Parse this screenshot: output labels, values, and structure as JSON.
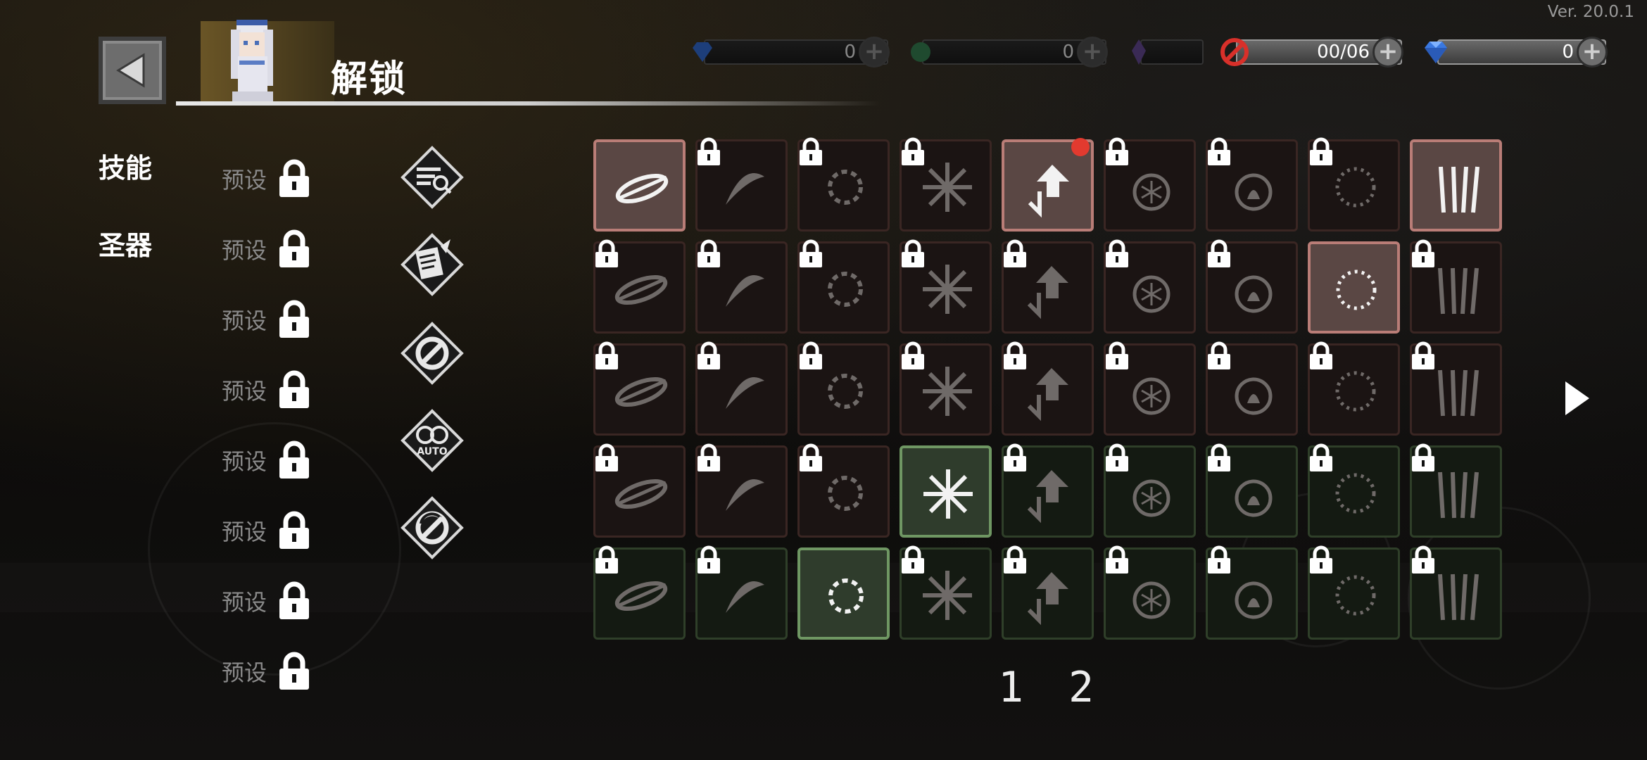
{
  "version": "Ver. 20.0.1",
  "header": {
    "title": "解锁"
  },
  "currencies": [
    {
      "icon": "diamond-icon",
      "value": "0",
      "active": false
    },
    {
      "icon": "green-orb-icon",
      "value": "0",
      "active": false
    },
    {
      "icon": "purple-crystal-icon",
      "value": "",
      "active": false
    },
    {
      "icon": "no-entry-icon",
      "value": "00/06",
      "active": true
    },
    {
      "icon": "diamond-icon",
      "value": "0",
      "active": true
    }
  ],
  "nav": {
    "skills_label": "技能",
    "relics_label": "圣器"
  },
  "presets": [
    {
      "label": "预设",
      "locked": true
    },
    {
      "label": "预设",
      "locked": true
    },
    {
      "label": "预设",
      "locked": true
    },
    {
      "label": "预设",
      "locked": true
    },
    {
      "label": "预设",
      "locked": true
    },
    {
      "label": "预设",
      "locked": true
    },
    {
      "label": "预设",
      "locked": true
    },
    {
      "label": "预设",
      "locked": true
    }
  ],
  "utility_icons": [
    "filter-search-icon",
    "scroll-quill-icon",
    "no-entry-diamond-icon",
    "auto-icon",
    "no-cycle-icon"
  ],
  "utility_auto_text": "AUTO",
  "skills": [
    {
      "icon": "slash-orbit-icon",
      "locked": false,
      "active": true,
      "tier": "red"
    },
    {
      "icon": "sword-spin-icon",
      "locked": true,
      "active": false,
      "tier": "red"
    },
    {
      "icon": "explosion-icon",
      "locked": true,
      "active": false,
      "tier": "red"
    },
    {
      "icon": "burst-icon",
      "locked": true,
      "active": false,
      "tier": "red"
    },
    {
      "icon": "arrows-up-down-icon",
      "locked": false,
      "active": true,
      "tier": "red",
      "notification": true
    },
    {
      "icon": "frost-bomb-icon",
      "locked": true,
      "active": false,
      "tier": "red"
    },
    {
      "icon": "fire-bomb-icon",
      "locked": true,
      "active": false,
      "tier": "red"
    },
    {
      "icon": "vortex-ring-icon",
      "locked": true,
      "active": false,
      "tier": "red"
    },
    {
      "icon": "spikes-icon",
      "locked": false,
      "active": true,
      "tier": "red"
    },
    {
      "icon": "biohazard-icon",
      "locked": true,
      "active": false,
      "tier": "red"
    },
    {
      "icon": "crescent-blade-icon",
      "locked": true,
      "active": false,
      "tier": "red"
    },
    {
      "icon": "wind-slash-icon",
      "locked": true,
      "active": false,
      "tier": "red"
    },
    {
      "icon": "comet-icon",
      "locked": true,
      "active": false,
      "tier": "red"
    },
    {
      "icon": "crosshair-icon",
      "locked": true,
      "active": false,
      "tier": "red"
    },
    {
      "icon": "ice-sword-icon",
      "locked": true,
      "active": false,
      "tier": "red"
    },
    {
      "icon": "spiral-icon",
      "locked": true,
      "active": false,
      "tier": "red"
    },
    {
      "icon": "target-orb-icon",
      "locked": false,
      "active": true,
      "tier": "red"
    },
    {
      "icon": "thorn-vine-icon",
      "locked": true,
      "active": false,
      "tier": "red"
    },
    {
      "icon": "poison-cloud-icon",
      "locked": true,
      "active": false,
      "tier": "red"
    },
    {
      "icon": "fist-icon",
      "locked": true,
      "active": false,
      "tier": "red"
    },
    {
      "icon": "eye-ring-icon",
      "locked": true,
      "active": false,
      "tier": "red"
    },
    {
      "icon": "claw-slash-icon",
      "locked": true,
      "active": false,
      "tier": "red"
    },
    {
      "icon": "lightning-bomb-icon",
      "locked": true,
      "active": false,
      "tier": "red"
    },
    {
      "icon": "feather-slash-icon",
      "locked": true,
      "active": false,
      "tier": "red"
    },
    {
      "icon": "spear-icon",
      "locked": true,
      "active": false,
      "tier": "red"
    },
    {
      "icon": "cross-slash-icon",
      "locked": true,
      "active": false,
      "tier": "red"
    },
    {
      "icon": "pulse-wave-icon",
      "locked": true,
      "active": false,
      "tier": "red"
    },
    {
      "icon": "fireball-icon",
      "locked": true,
      "active": false,
      "tier": "red"
    },
    {
      "icon": "grass-burst-icon",
      "locked": true,
      "active": false,
      "tier": "red"
    },
    {
      "icon": "splash-icon",
      "locked": true,
      "active": false,
      "tier": "red"
    },
    {
      "icon": "shark-fin-icon",
      "locked": false,
      "active": true,
      "tier": "green"
    },
    {
      "icon": "chain-icon",
      "locked": true,
      "active": false,
      "tier": "green"
    },
    {
      "icon": "lightning-icon",
      "locked": true,
      "active": false,
      "tier": "green"
    },
    {
      "icon": "anvil-icon",
      "locked": true,
      "active": false,
      "tier": "green"
    },
    {
      "icon": "flame-ring-icon",
      "locked": true,
      "active": false,
      "tier": "green"
    },
    {
      "icon": "skull-burst-icon",
      "locked": true,
      "active": false,
      "tier": "green"
    },
    {
      "icon": "biohazard-icon",
      "locked": true,
      "active": false,
      "tier": "green"
    },
    {
      "icon": "lance-icon",
      "locked": true,
      "active": false,
      "tier": "green"
    },
    {
      "icon": "flame-orb-icon",
      "locked": false,
      "active": true,
      "tier": "green"
    },
    {
      "icon": "boomerang-icon",
      "locked": true,
      "active": false,
      "tier": "green"
    },
    {
      "icon": "daggers-icon",
      "locked": true,
      "active": false,
      "tier": "green"
    },
    {
      "icon": "shatter-icon",
      "locked": true,
      "active": false,
      "tier": "green"
    },
    {
      "icon": "scatter-icon",
      "locked": true,
      "active": false,
      "tier": "green"
    },
    {
      "icon": "crystal-icon",
      "locked": true,
      "active": false,
      "tier": "green"
    },
    {
      "icon": "tornado-icon",
      "locked": true,
      "active": false,
      "tier": "green"
    }
  ],
  "pagination": {
    "pages": [
      "1",
      "2"
    ]
  },
  "colors": {
    "red_tile_border": "#3a2623",
    "green_tile_border": "#2f3f29",
    "notification": "#e23a2f"
  }
}
